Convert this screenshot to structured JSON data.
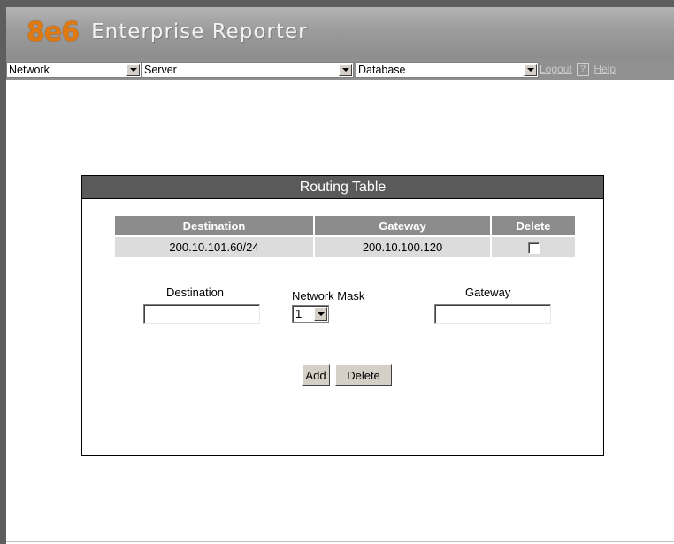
{
  "app": {
    "logo_mark": "8e6",
    "logo_text": "Enterprise Reporter"
  },
  "nav": {
    "selects": [
      {
        "value": "Network"
      },
      {
        "value": "Server"
      },
      {
        "value": "Database"
      }
    ],
    "logout_label": "Logout",
    "help_icon_glyph": "?",
    "help_label": "Help"
  },
  "routing": {
    "title": "Routing Table",
    "columns": [
      "Destination",
      "Gateway",
      "Delete"
    ],
    "rows": [
      {
        "destination": "200.10.101.60/24",
        "gateway": "200.10.100.120",
        "delete_checked": false
      }
    ],
    "form": {
      "destination_label": "Destination",
      "mask_label": "Network Mask",
      "mask_value": "1",
      "gateway_label": "Gateway",
      "destination_value": "",
      "gateway_value": ""
    },
    "add_label": "Add",
    "delete_label": "Delete"
  },
  "colors": {
    "logo_orange": "#e07a10",
    "header_gray": "#9c9c9c",
    "panel_title_bg": "#5a5a5a",
    "table_header_bg": "#8c8c8c",
    "table_row_bg": "#dcdcdc"
  }
}
